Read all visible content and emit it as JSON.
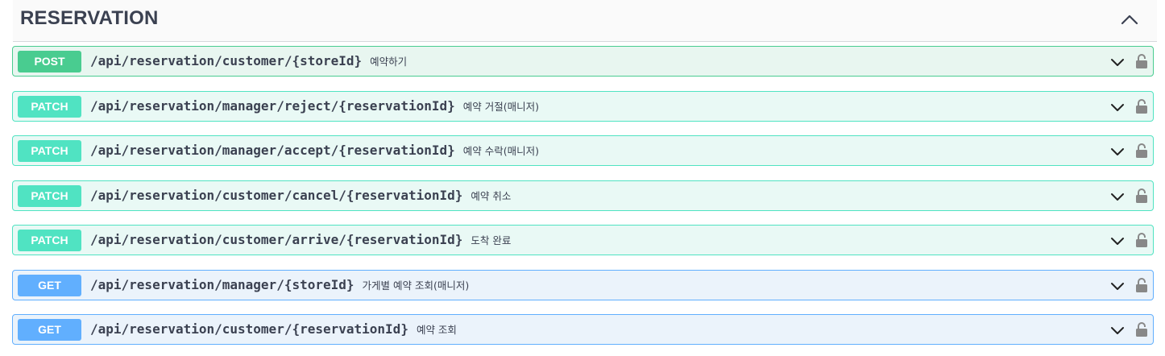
{
  "section": {
    "title": "RESERVATION",
    "toggle_icon": "chevron-up-icon"
  },
  "operations": [
    {
      "method": "POST",
      "path": "/api/reservation/customer/{storeId}",
      "summary": "예약하기",
      "color": "#49cc90"
    },
    {
      "method": "PATCH",
      "path": "/api/reservation/manager/reject/{reservationId}",
      "summary": "예약 거절(매니저)",
      "color": "#50e3c2"
    },
    {
      "method": "PATCH",
      "path": "/api/reservation/manager/accept/{reservationId}",
      "summary": "예약 수락(매니저)",
      "color": "#50e3c2"
    },
    {
      "method": "PATCH",
      "path": "/api/reservation/customer/cancel/{reservationId}",
      "summary": "예약 취소",
      "color": "#50e3c2"
    },
    {
      "method": "PATCH",
      "path": "/api/reservation/customer/arrive/{reservationId}",
      "summary": "도착 완료",
      "color": "#50e3c2"
    },
    {
      "method": "GET",
      "path": "/api/reservation/manager/{storeId}",
      "summary": "가게별 예약 조회(매니저)",
      "color": "#61affe"
    },
    {
      "method": "GET",
      "path": "/api/reservation/customer/{reservationId}",
      "summary": "예약 조회",
      "color": "#61affe"
    }
  ],
  "icons": {
    "expand": "chevron-down-icon",
    "auth": "lock-icon"
  }
}
